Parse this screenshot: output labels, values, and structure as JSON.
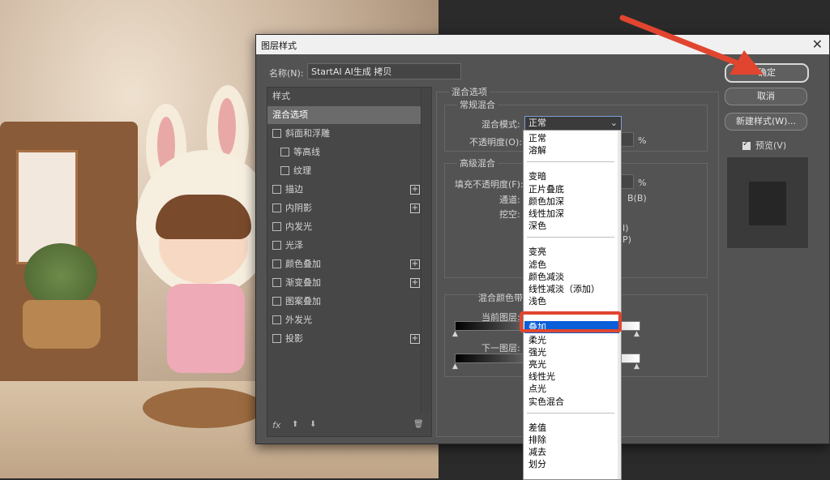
{
  "dialog": {
    "title": "图层样式",
    "close": "✕",
    "name_label": "名称(N):",
    "name_value": "StartAI AI生成 拷贝"
  },
  "style_list": {
    "header": "样式",
    "items": [
      {
        "label": "混合选项",
        "selected": true,
        "checkbox": false,
        "plus": false
      },
      {
        "label": "斜面和浮雕",
        "checkbox": true,
        "plus": false
      },
      {
        "label": "等高线",
        "checkbox": true,
        "plus": false,
        "indent": true
      },
      {
        "label": "纹理",
        "checkbox": true,
        "plus": false,
        "indent": true
      },
      {
        "label": "描边",
        "checkbox": true,
        "plus": true
      },
      {
        "label": "内阴影",
        "checkbox": true,
        "plus": true
      },
      {
        "label": "内发光",
        "checkbox": true,
        "plus": false
      },
      {
        "label": "光泽",
        "checkbox": true,
        "plus": false
      },
      {
        "label": "颜色叠加",
        "checkbox": true,
        "plus": true
      },
      {
        "label": "渐变叠加",
        "checkbox": true,
        "plus": true
      },
      {
        "label": "图案叠加",
        "checkbox": true,
        "plus": false
      },
      {
        "label": "外发光",
        "checkbox": true,
        "plus": false
      },
      {
        "label": "投影",
        "checkbox": true,
        "plus": true
      }
    ],
    "footer_fx": "fx",
    "footer_up": "⬆",
    "footer_down": "⬇",
    "footer_trash": "🗑"
  },
  "blend_options": {
    "section_title": "混合选项",
    "general_title": "常规混合",
    "blend_mode_label": "混合模式:",
    "blend_mode_value": "正常",
    "opacity_label": "不透明度(O):",
    "percent": "%",
    "advanced_title": "高级混合",
    "fill_opacity_label": "填充不透明度(F):",
    "channels_label": "通道:",
    "channel_b": "B(B)",
    "knockout_label": "挖空:",
    "paren1": "I)",
    "paren2": "P)",
    "blend_if_label": "混合颜色带:",
    "this_layer_label": "当前图层:",
    "underlying_label": "下一图层:"
  },
  "dropdown": {
    "groups": [
      [
        "正常",
        "溶解"
      ],
      [
        "变暗",
        "正片叠底",
        "颜色加深",
        "线性加深",
        "深色"
      ],
      [
        "变亮",
        "滤色",
        "颜色减淡",
        "线性减淡（添加）",
        "浅色"
      ],
      [
        "叠加",
        "柔光",
        "强光",
        "亮光",
        "线性光",
        "点光",
        "实色混合"
      ],
      [
        "差值",
        "排除",
        "减去",
        "划分"
      ]
    ],
    "highlighted": "叠加"
  },
  "buttons": {
    "ok": "确定",
    "cancel": "取消",
    "new_style": "新建样式(W)...",
    "preview": "预览(V)"
  },
  "colors": {
    "accent": "#0a5fd8",
    "annotation": "#e1452f"
  }
}
